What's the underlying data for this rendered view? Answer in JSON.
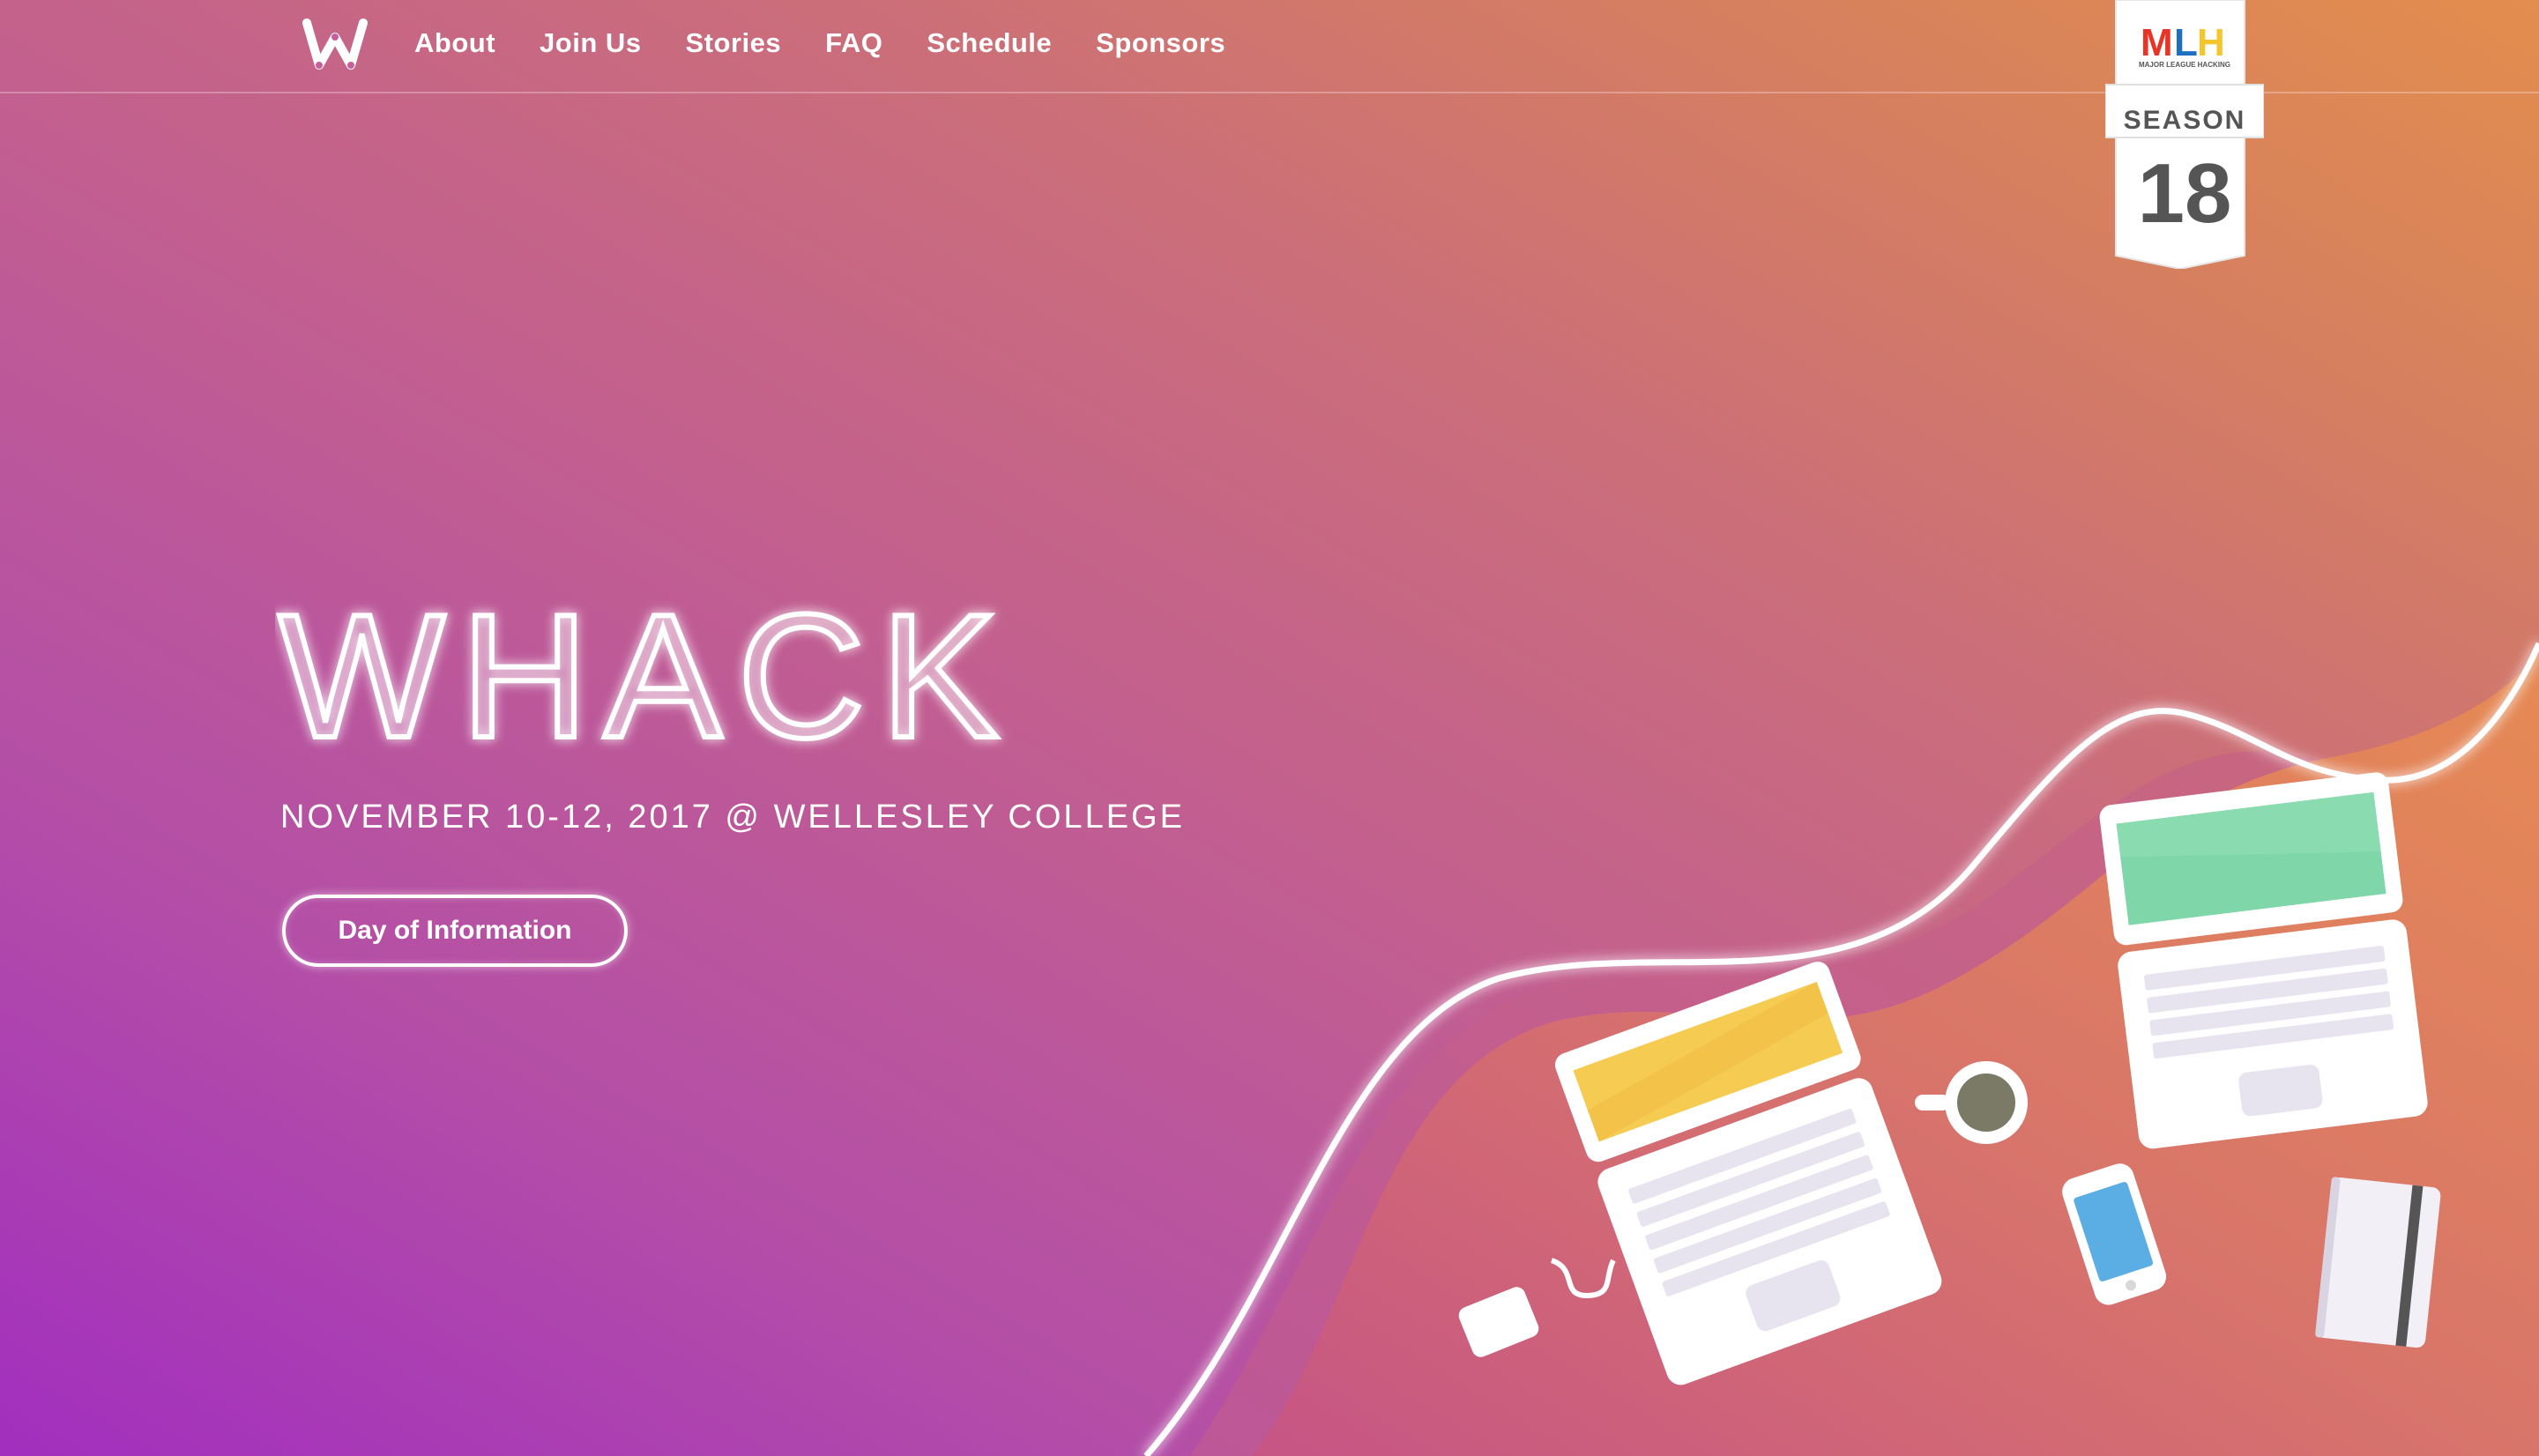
{
  "nav": {
    "logo_icon": "whack-w-logo-icon",
    "links": [
      "About",
      "Join Us",
      "Stories",
      "FAQ",
      "Schedule",
      "Sponsors"
    ]
  },
  "mlh_badge": {
    "logo_text": "MLH",
    "logo_subtext": "MAJOR LEAGUE HACKING",
    "season_label": "SEASON",
    "season_number": "18"
  },
  "hero": {
    "title": "WHACK",
    "date_location": "NOVEMBER 10-12, 2017 @ WELLESLEY COLLEGE",
    "button_label": "Day of Information"
  },
  "illustration_icons": [
    "laptop-icon",
    "laptop-icon",
    "coffee-cup-icon",
    "smartphone-icon",
    "notebook-icon",
    "mouse-icon"
  ],
  "colors": {
    "gradient_start": "#a22fbe",
    "gradient_end": "#e38d4e",
    "accent_white": "#ffffff",
    "laptop_screen_yellow": "#f6cb52",
    "laptop_screen_green": "#7fd6a9",
    "phone_screen_blue": "#5aaee3"
  }
}
